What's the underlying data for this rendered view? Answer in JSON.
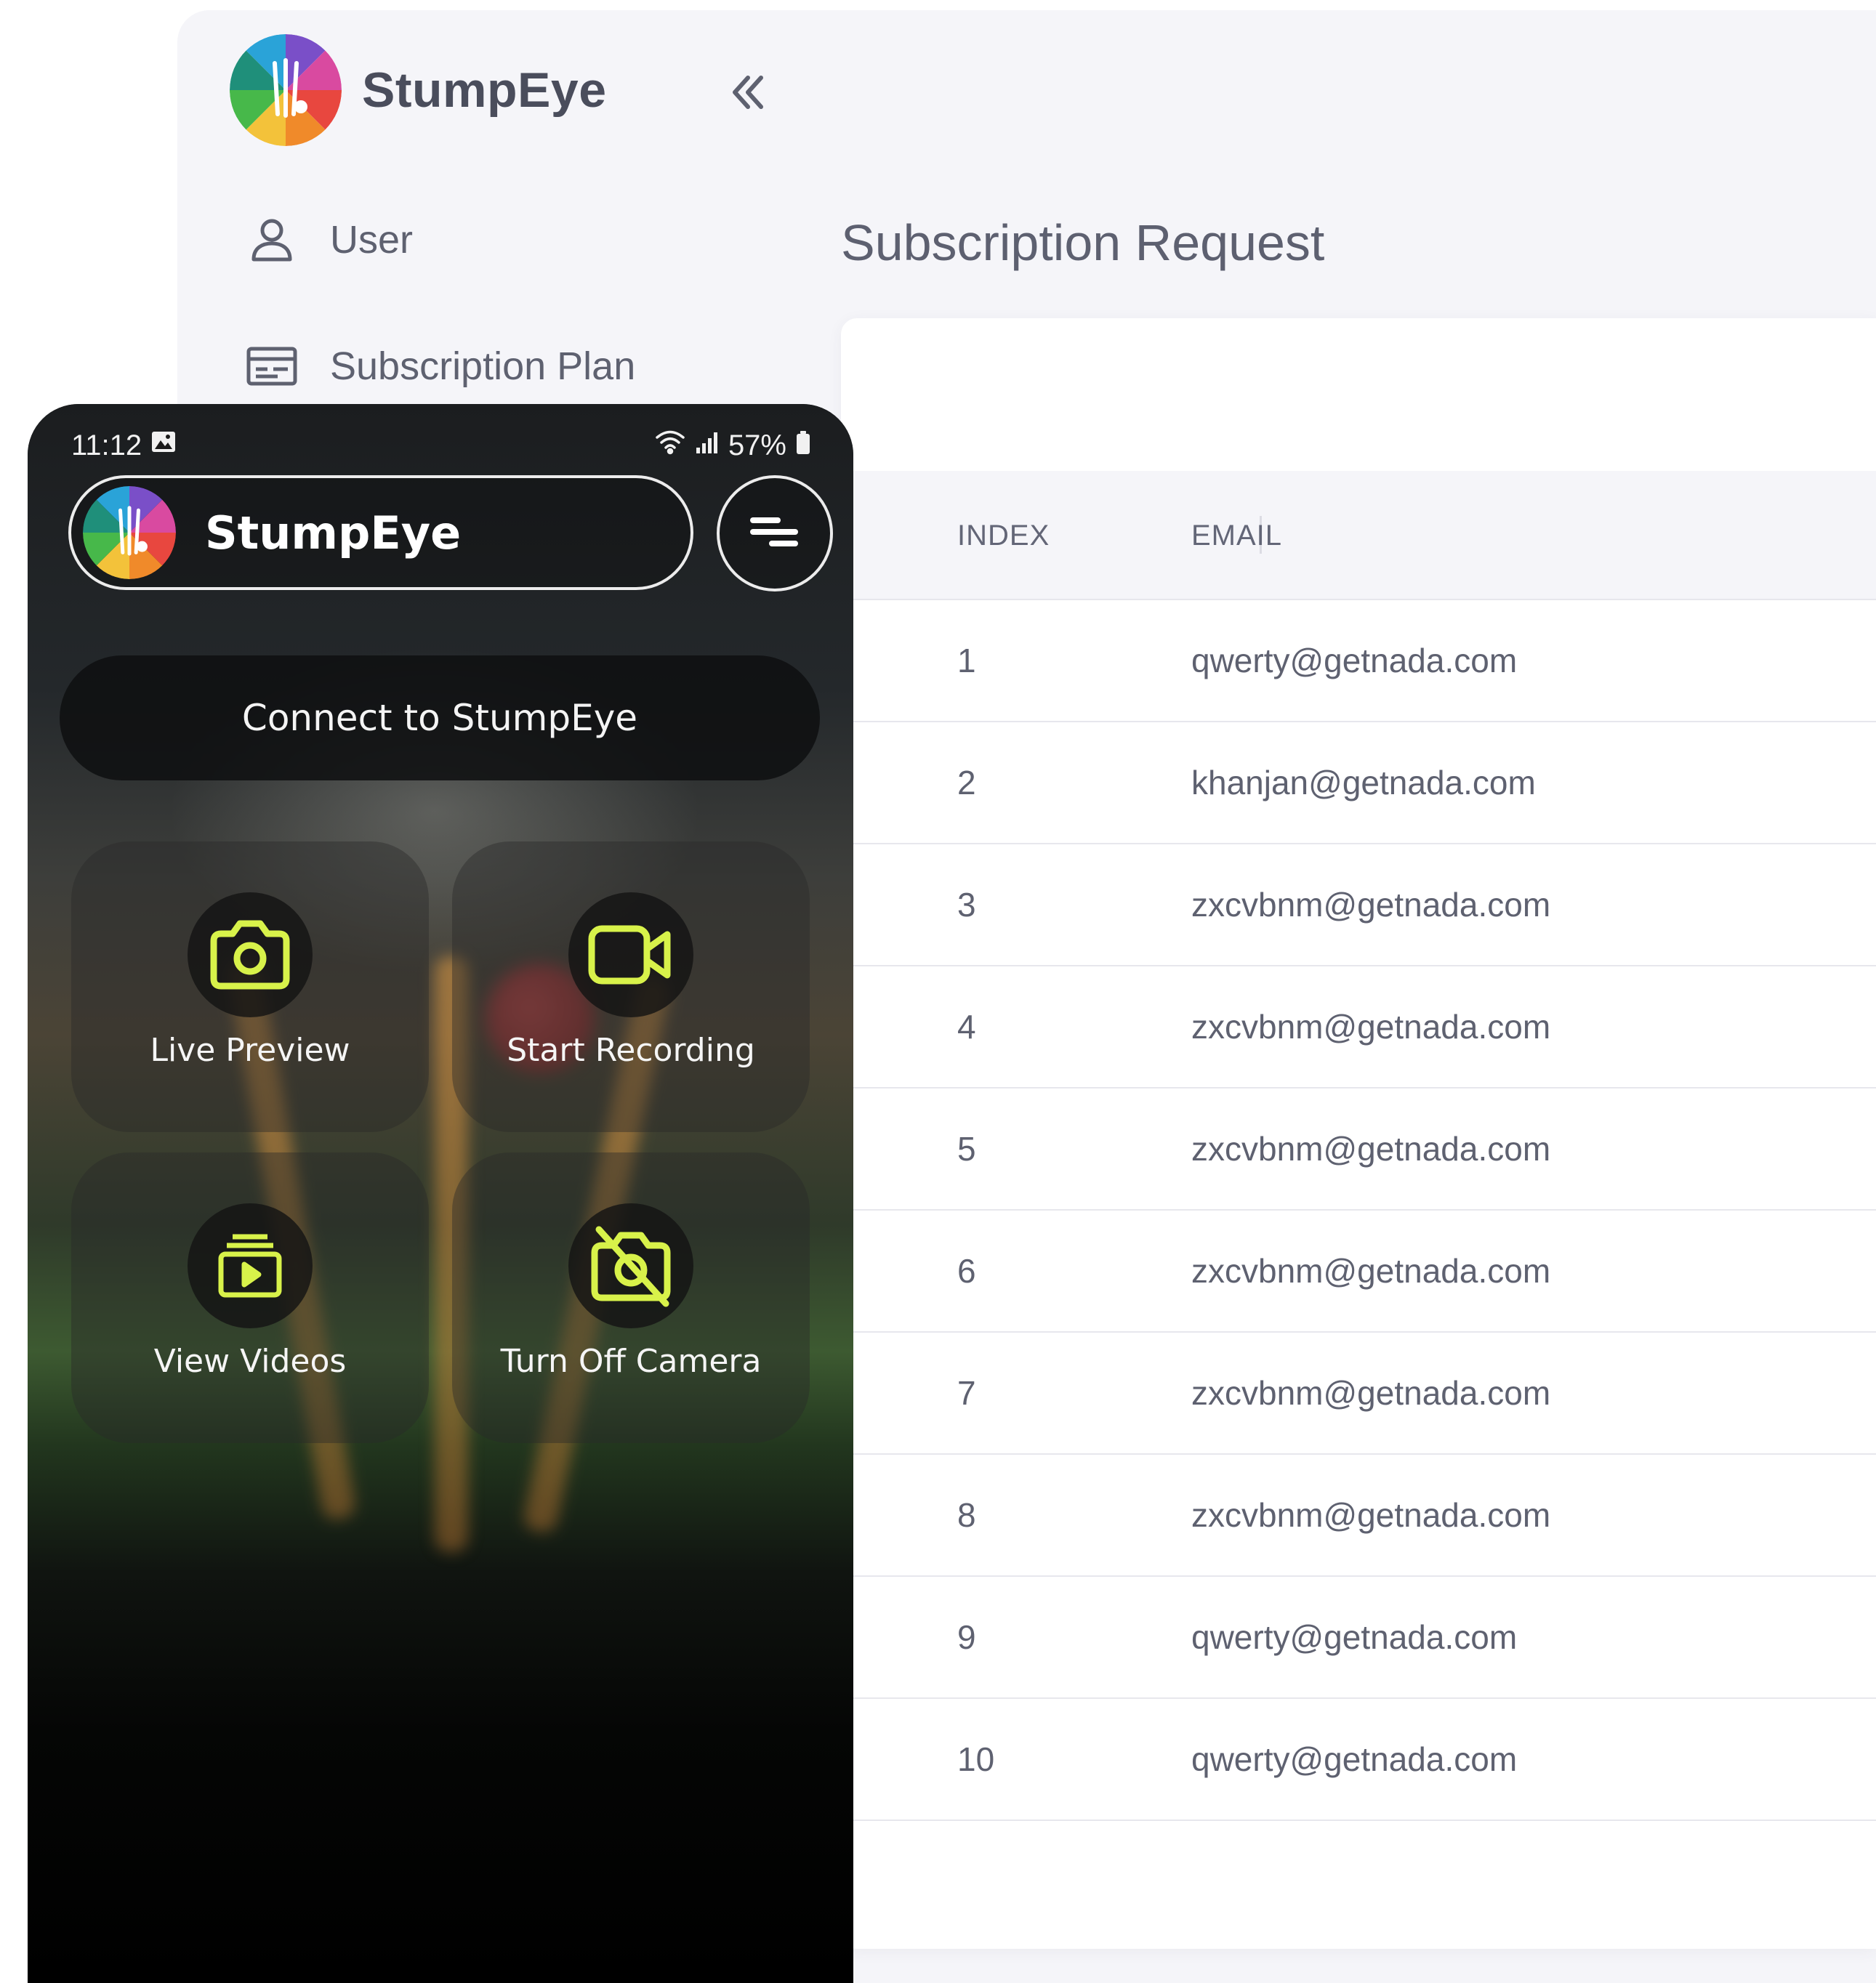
{
  "admin": {
    "brand_name": "StumpEye",
    "nav": [
      {
        "label": "User",
        "icon": "user-icon"
      },
      {
        "label": "Subscription Plan",
        "icon": "card-icon"
      }
    ],
    "page_title": "Subscription Request",
    "table": {
      "columns": [
        "INDEX",
        "EMAIL"
      ],
      "rows": [
        {
          "index": "1",
          "email": "qwerty@getnada.com"
        },
        {
          "index": "2",
          "email": "khanjan@getnada.com"
        },
        {
          "index": "3",
          "email": "zxcvbnm@getnada.com"
        },
        {
          "index": "4",
          "email": "zxcvbnm@getnada.com"
        },
        {
          "index": "5",
          "email": "zxcvbnm@getnada.com"
        },
        {
          "index": "6",
          "email": "zxcvbnm@getnada.com"
        },
        {
          "index": "7",
          "email": "zxcvbnm@getnada.com"
        },
        {
          "index": "8",
          "email": "zxcvbnm@getnada.com"
        },
        {
          "index": "9",
          "email": "qwerty@getnada.com"
        },
        {
          "index": "10",
          "email": "qwerty@getnada.com"
        }
      ]
    }
  },
  "phone": {
    "status": {
      "time": "11:12",
      "battery": "57%"
    },
    "app_title": "StumpEye",
    "connect_label": "Connect to StumpEye",
    "tiles": [
      {
        "label": "Live Preview",
        "icon": "camera-icon"
      },
      {
        "label": "Start Recording",
        "icon": "video-camera-icon"
      },
      {
        "label": "View Videos",
        "icon": "video-library-icon"
      },
      {
        "label": "Turn Off Camera",
        "icon": "camera-off-icon"
      }
    ]
  },
  "colors": {
    "accent_yellow": "#d8f24a",
    "admin_bg": "#f5f5f9",
    "text_gray": "#5e6170"
  }
}
